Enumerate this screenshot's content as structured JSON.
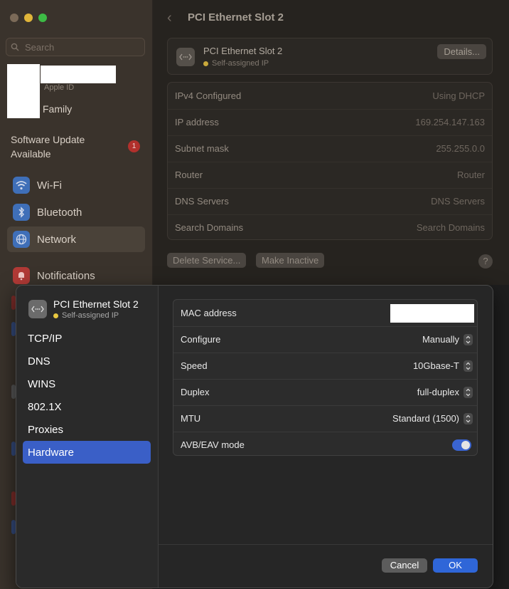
{
  "sidebar": {
    "search_placeholder": "Search",
    "apple_id_label": "Apple ID",
    "family_label": "Family",
    "software_update": "Software Update Available",
    "software_update_badge": "1",
    "items": [
      {
        "label": "Wi-Fi",
        "icon": "wifi-icon"
      },
      {
        "label": "Bluetooth",
        "icon": "bluetooth-icon"
      },
      {
        "label": "Network",
        "icon": "network-icon"
      },
      {
        "label": "Notifications",
        "icon": "notifications-icon"
      }
    ]
  },
  "main": {
    "title": "PCI Ethernet Slot 2",
    "service_name": "PCI Ethernet Slot 2",
    "service_status": "Self-assigned IP",
    "details_label": "Details...",
    "rows": [
      {
        "key": "IPv4 Configured",
        "value": "Using DHCP"
      },
      {
        "key": "IP address",
        "value": "169.254.147.163"
      },
      {
        "key": "Subnet mask",
        "value": "255.255.0.0"
      },
      {
        "key": "Router",
        "value": "Router"
      },
      {
        "key": "DNS Servers",
        "value": "DNS Servers"
      },
      {
        "key": "Search Domains",
        "value": "Search Domains"
      }
    ],
    "delete_service_label": "Delete Service...",
    "make_inactive_label": "Make Inactive",
    "help_label": "?"
  },
  "sheet": {
    "service_name": "PCI Ethernet Slot 2",
    "service_status": "Self-assigned IP",
    "tabs": [
      "TCP/IP",
      "DNS",
      "WINS",
      "802.1X",
      "Proxies",
      "Hardware"
    ],
    "active_tab": "Hardware",
    "hardware": {
      "mac_label": "MAC address",
      "configure_label": "Configure",
      "configure_value": "Manually",
      "speed_label": "Speed",
      "speed_value": "10Gbase-T",
      "duplex_label": "Duplex",
      "duplex_value": "full-duplex",
      "mtu_label": "MTU",
      "mtu_value": "Standard (1500)",
      "avb_label": "AVB/EAV mode",
      "avb_enabled": true
    },
    "cancel_label": "Cancel",
    "ok_label": "OK"
  },
  "colors": {
    "accent": "#3a5fc7",
    "ok_button": "#2f66d8",
    "status_dot": "#e8c840",
    "badge": "#b1302c"
  }
}
